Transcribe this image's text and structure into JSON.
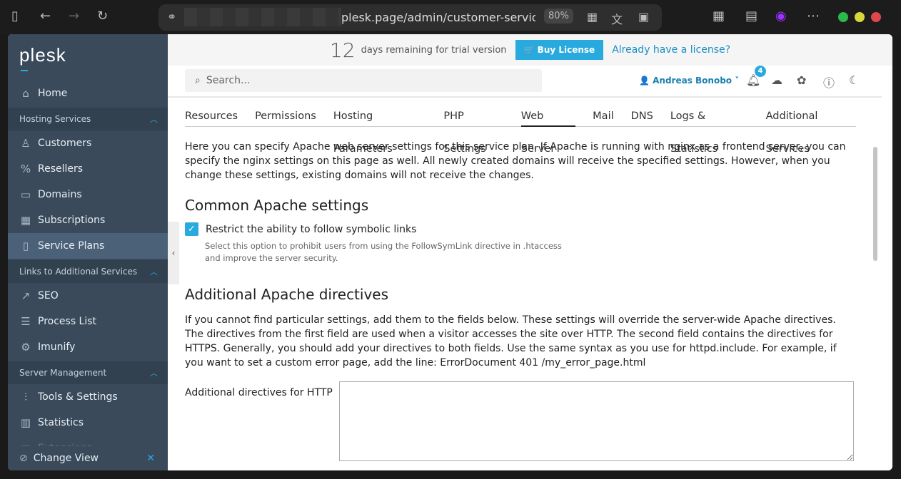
{
  "browser": {
    "url": "plesk.page/admin/customer-service",
    "zoom": "80%"
  },
  "sidebar": {
    "logo": "plesk",
    "items": [
      {
        "label": "Home",
        "icon": "home-icon"
      },
      {
        "group": "Hosting Services"
      },
      {
        "label": "Customers",
        "icon": "user-icon"
      },
      {
        "label": "Resellers",
        "icon": "percent-icon"
      },
      {
        "label": "Domains",
        "icon": "monitor-icon"
      },
      {
        "label": "Subscriptions",
        "icon": "grid-icon"
      },
      {
        "label": "Service Plans",
        "icon": "book-icon",
        "active": true
      },
      {
        "group": "Links to Additional Services"
      },
      {
        "label": "SEO",
        "icon": "chart-icon"
      },
      {
        "label": "Process List",
        "icon": "list-icon"
      },
      {
        "label": "Imunify",
        "icon": "gear-icon"
      },
      {
        "group": "Server Management"
      },
      {
        "label": "Tools & Settings",
        "icon": "sliders-icon"
      },
      {
        "label": "Statistics",
        "icon": "bar-chart-icon"
      },
      {
        "label": "Extensions",
        "icon": "extensions-icon"
      }
    ],
    "change_view": "Change View"
  },
  "trial": {
    "days": "12",
    "text": "days remaining for trial version",
    "buy": "Buy License",
    "have": "Already have a license?"
  },
  "header": {
    "search_placeholder": "Search...",
    "user": "Andreas Bonobo",
    "notifications": "4"
  },
  "tabs": [
    "Resources",
    "Permissions",
    "Hosting Parameters",
    "PHP Settings",
    "Web Server",
    "Mail",
    "DNS",
    "Logs & Statistics",
    "Additional Services"
  ],
  "active_tab": "Web Server",
  "main": {
    "intro": "Here you can specify Apache web server settings for this service plan. If Apache is running with nginx as a frontend server, you can specify the nginx settings on this page as well. All newly created domains will receive the specified settings. However, when you change these settings, existing domains will not receive the changes.",
    "common_heading": "Common Apache settings",
    "symlink_label": "Restrict the ability to follow symbolic links",
    "symlink_checked": true,
    "symlink_hint1": "Select this option to prohibit users from using the FollowSymLink directive in .htaccess",
    "symlink_hint2": "and improve the server security.",
    "additional_heading": "Additional Apache directives",
    "additional_text": "If you cannot find particular settings, add them to the fields below. These settings will override the server-wide Apache directives. The directives from the first field are used when a visitor accesses the site over HTTP. The second field contains the directives for HTTPS. Generally, you should add your directives to both fields. Use the same syntax as you use for httpd.include. For example, if you want to set a custom error page, add the line: ErrorDocument 401 /my_error_page.html",
    "http_label": "Additional directives for HTTP",
    "http_value": ""
  }
}
